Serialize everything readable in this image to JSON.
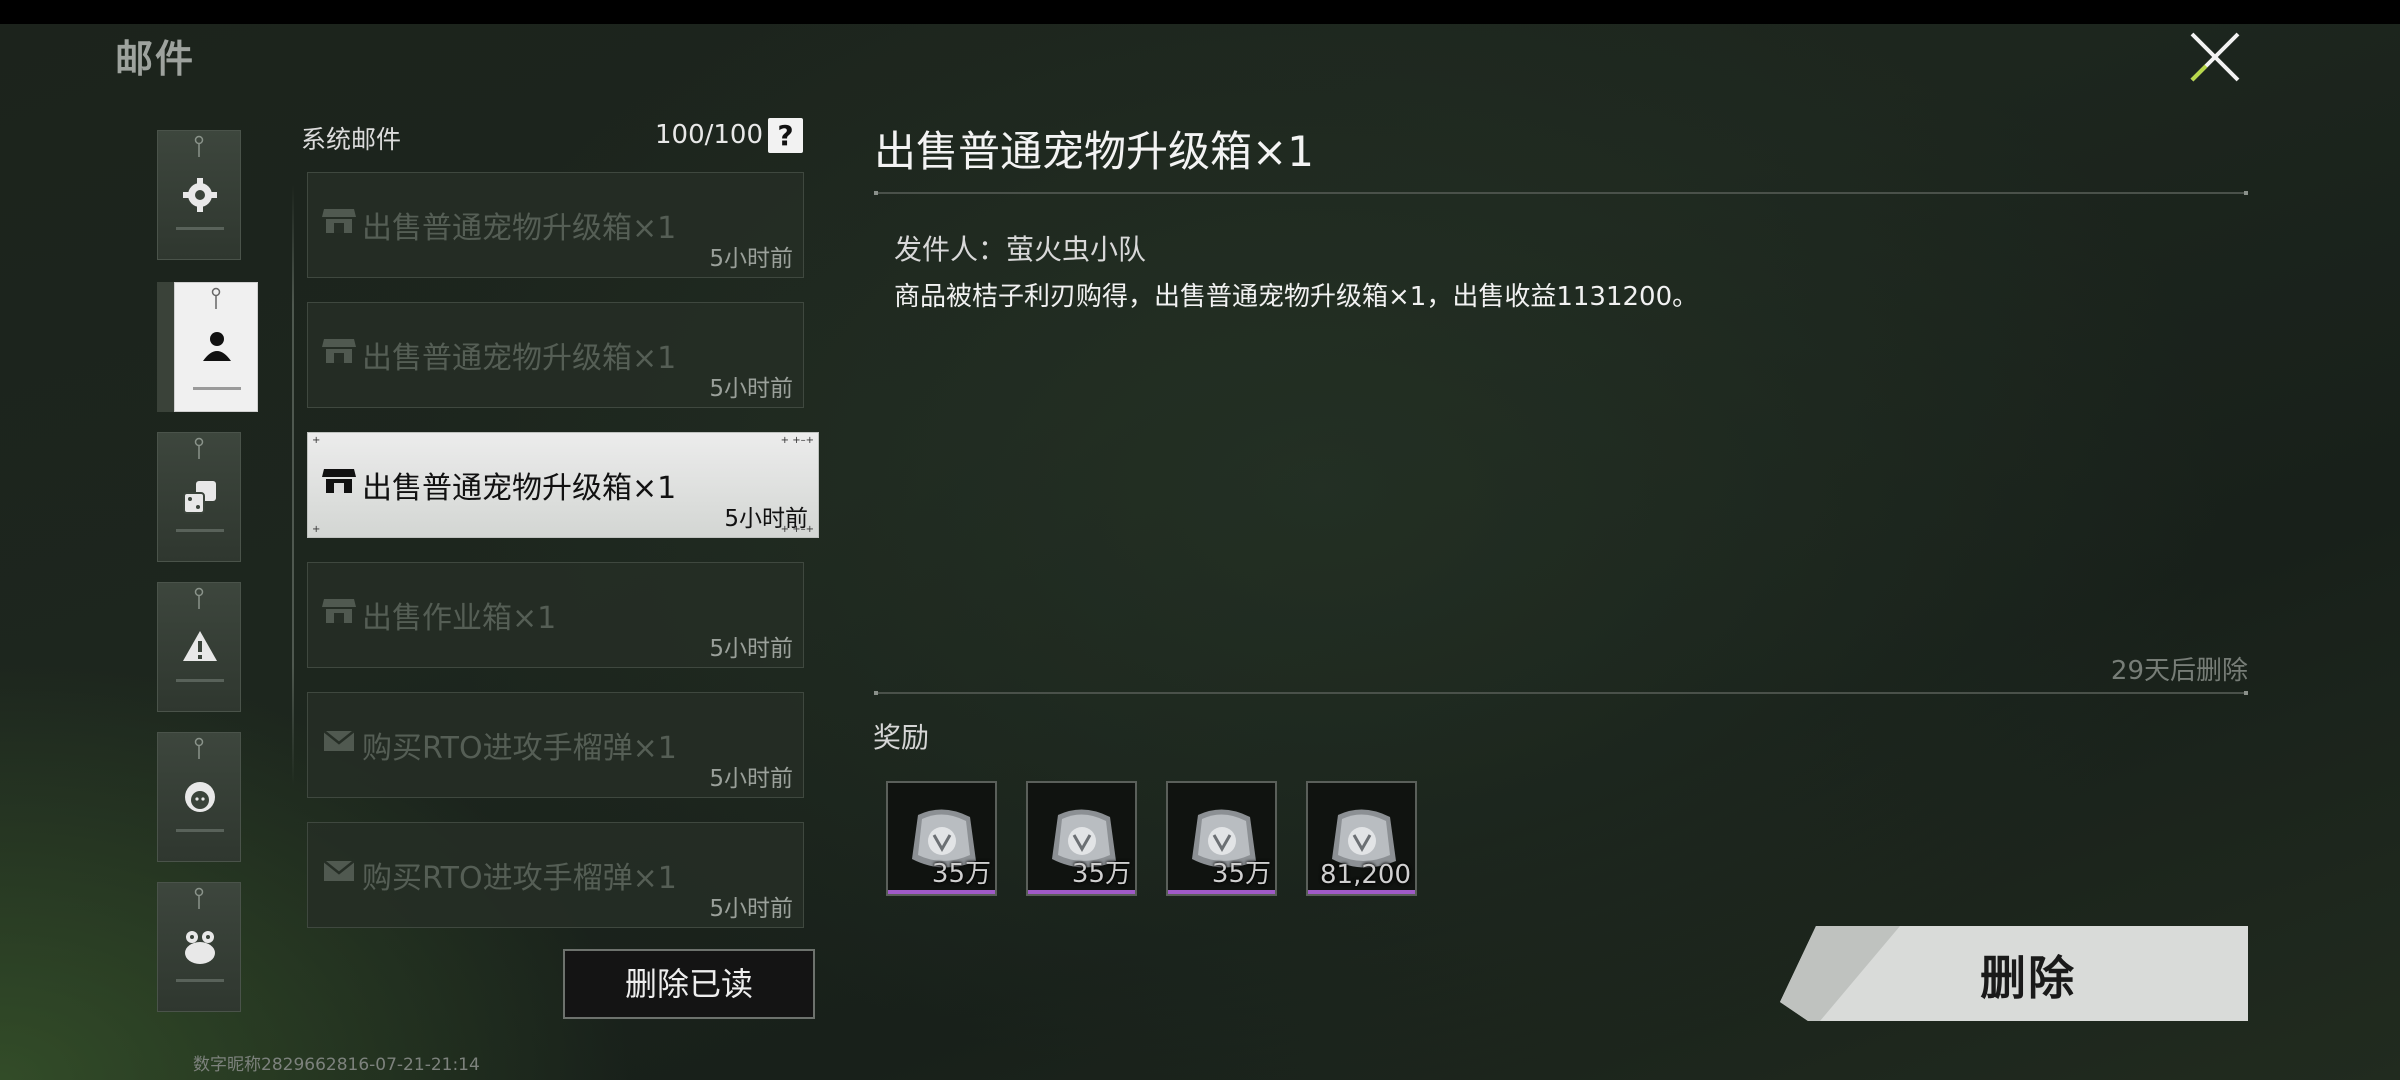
{
  "header": {
    "title": "邮件"
  },
  "categories": [
    {
      "name": "settings",
      "icon": "gear-icon",
      "active": false
    },
    {
      "name": "personal",
      "icon": "person-icon",
      "active": true
    },
    {
      "name": "events",
      "icon": "dice-icon",
      "active": false
    },
    {
      "name": "alerts",
      "icon": "warning-icon",
      "active": false
    },
    {
      "name": "friends",
      "icon": "girl-face-icon",
      "active": false
    },
    {
      "name": "pets",
      "icon": "frog-icon",
      "active": false
    }
  ],
  "mail_list": {
    "title": "系统邮件",
    "count": "100/100",
    "help": "?",
    "items": [
      {
        "subject": "出售普通宠物升级箱×1",
        "time": "5小时前",
        "icon": "shop-icon"
      },
      {
        "subject": "出售普通宠物升级箱×1",
        "time": "5小时前",
        "icon": "shop-icon"
      },
      {
        "subject": "出售普通宠物升级箱×1",
        "time": "5小时前",
        "icon": "shop-icon"
      },
      {
        "subject": "出售作业箱×1",
        "time": "5小时前",
        "icon": "shop-icon"
      },
      {
        "subject": "购买RTO进攻手榴弹×1",
        "time": "5小时前",
        "icon": "envelope-icon"
      },
      {
        "subject": "购买RTO进攻手榴弹×1",
        "time": "5小时前",
        "icon": "envelope-icon"
      }
    ],
    "delete_read_label": "删除已读"
  },
  "detail": {
    "title": "出售普通宠物升级箱×1",
    "sender": "发件人：萤火虫小队",
    "body": "商品被桔子利刃购得，出售普通宠物升级箱×1，出售收益1131200。",
    "expire": "29天后删除",
    "reward_label": "奖励",
    "rewards": [
      {
        "qty": "35万"
      },
      {
        "qty": "35万"
      },
      {
        "qty": "35万"
      },
      {
        "qty": "81,200"
      }
    ],
    "delete_label": "删除"
  },
  "footer": {
    "player_id": "数字昵称2829662816-07-21-21:14"
  },
  "colors": {
    "selected_bg": "#e6e6e6",
    "reward_rarity": "#a05ac8",
    "close_accent": "#b7d84a"
  }
}
